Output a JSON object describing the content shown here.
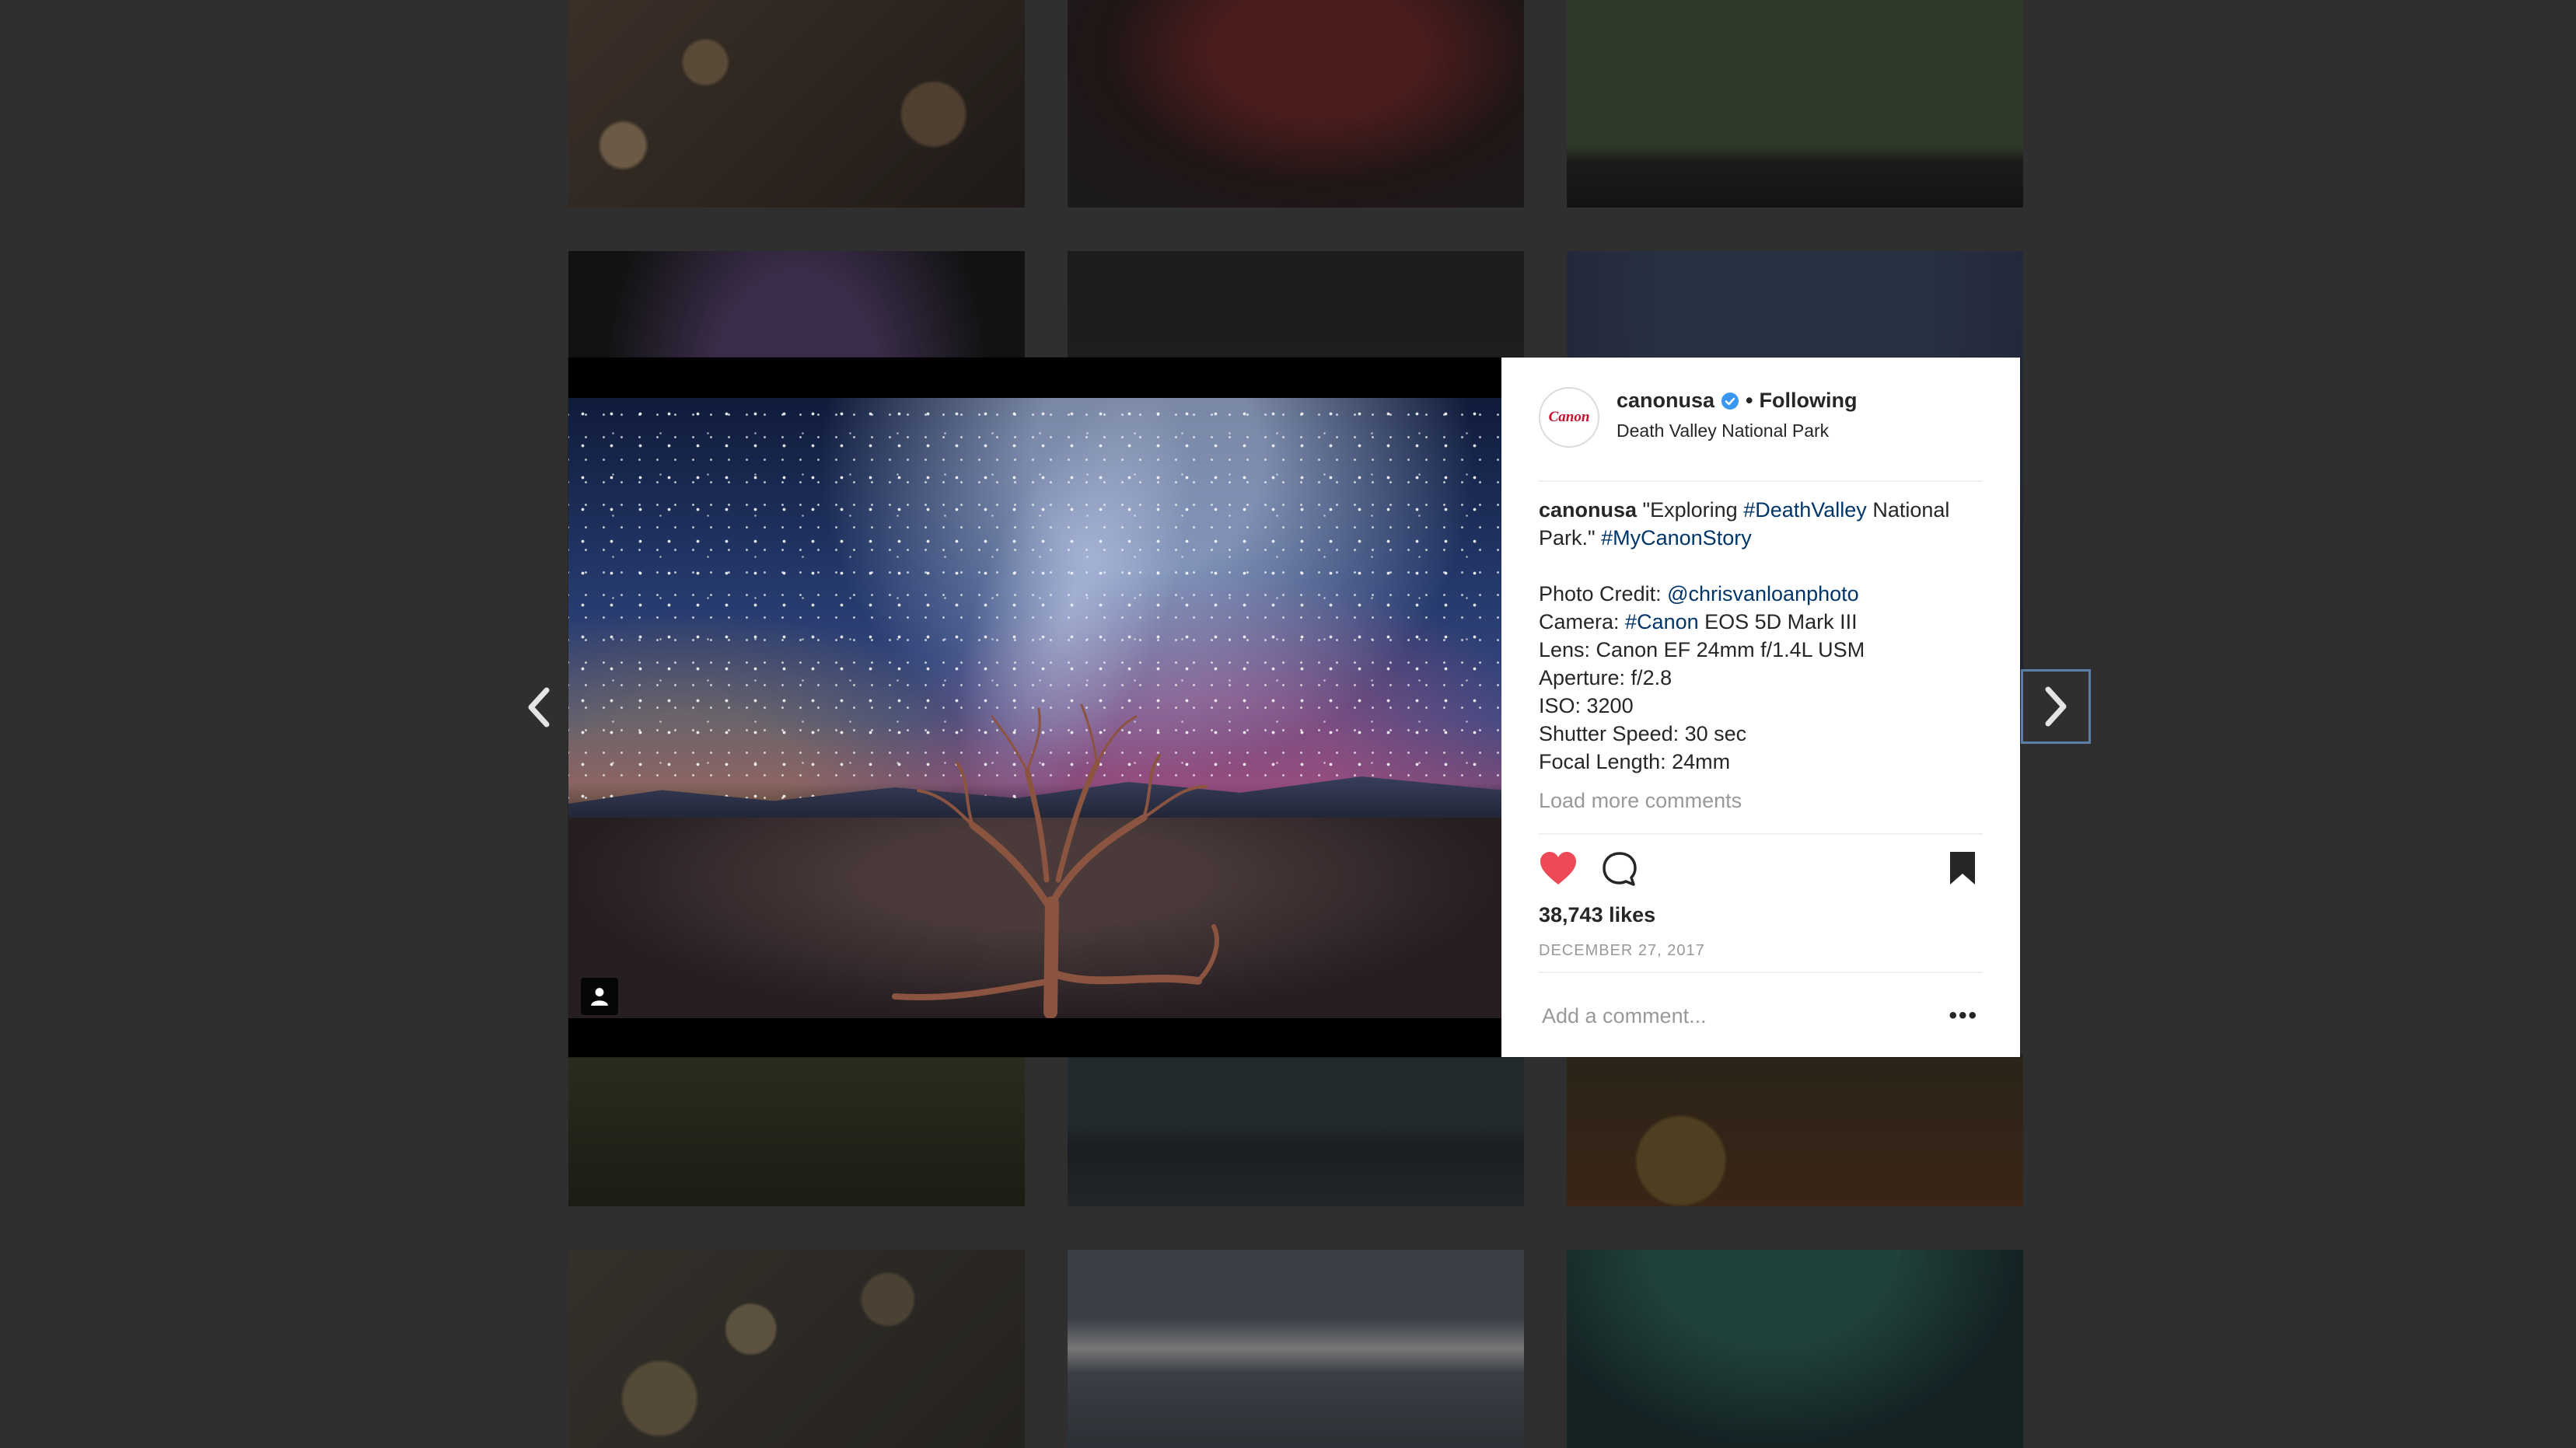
{
  "grid": [
    {
      "name": "tile-sparkles"
    },
    {
      "name": "tile-flower"
    },
    {
      "name": "tile-park-ceremony"
    },
    {
      "name": "tile-lights"
    },
    {
      "name": "tile-dark-sky"
    },
    {
      "name": "tile-night-sky"
    },
    {
      "name": "tile-plant"
    },
    {
      "name": "tile-mountain-lake"
    },
    {
      "name": "tile-christmas-tree"
    },
    {
      "name": "tile-bokeh"
    },
    {
      "name": "tile-snowy-mountain"
    },
    {
      "name": "tile-aurora"
    }
  ],
  "post": {
    "account": {
      "username": "canonusa",
      "avatar_text": "Canon",
      "separator": "•",
      "follow_status": "Following",
      "location": "Death Valley National Park"
    },
    "caption": {
      "username": "canonusa",
      "text_before": " \"Exploring ",
      "hashtag1": "#DeathValley",
      "text_after": " National Park.\" ",
      "hashtag2": "#MyCanonStory",
      "credit_label": "Photo Credit: ",
      "credit_handle": "@chrisvanloanphoto",
      "camera_label": "Camera: ",
      "camera_tag": "#Canon",
      "camera_model": " EOS 5D Mark III",
      "lens": "Lens: Canon EF 24mm f/1.4L USM",
      "aperture": "Aperture: f/2.8",
      "iso": "ISO: 3200",
      "shutter": "Shutter Speed: 30 sec",
      "focal": "Focal Length: 24mm"
    },
    "load_more": "Load more comments",
    "likes": "38,743 likes",
    "date": "DECEMBER 27, 2017",
    "comment_placeholder": "Add a comment...",
    "more_options": "•••"
  },
  "icons": {
    "prev": "chevron-left-icon",
    "next": "chevron-right-icon",
    "like": "heart-icon",
    "comment": "comment-icon",
    "save": "bookmark-icon",
    "tag": "user-tag-icon",
    "verified": "verified-badge-icon"
  },
  "colors": {
    "heart": "#ed4956",
    "link": "#003569",
    "verified": "#3897f0",
    "backdrop": "#2f2f2f"
  }
}
